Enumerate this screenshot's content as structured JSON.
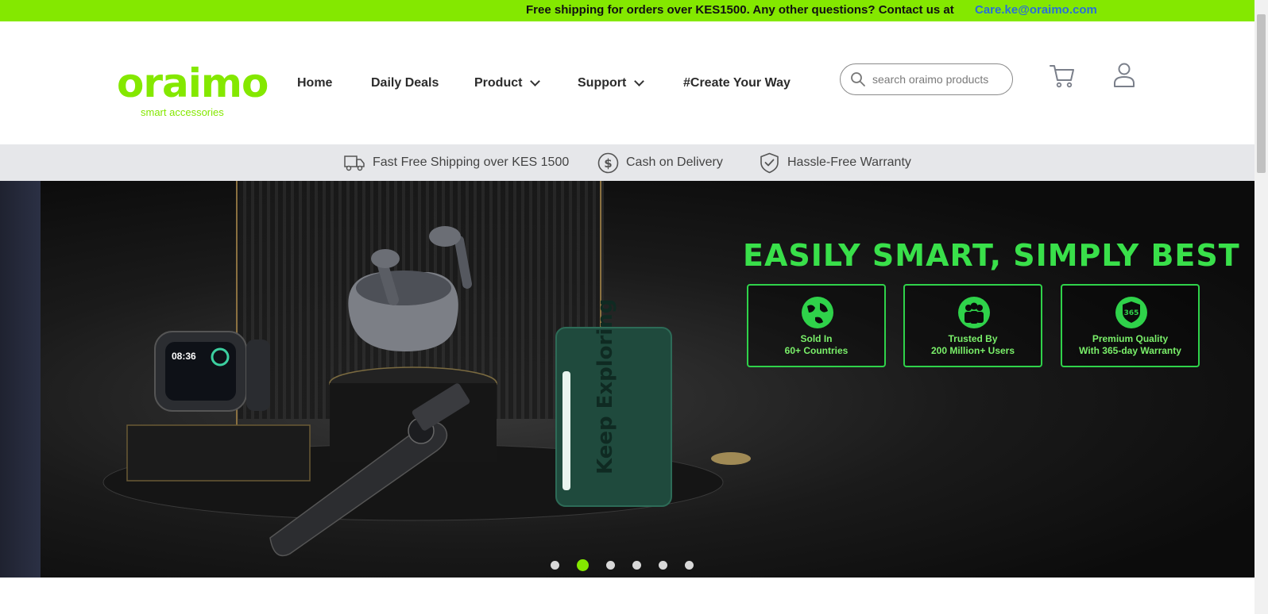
{
  "announcement": {
    "text": "Free shipping for orders over KES1500. Any other questions? Contact us at",
    "link": "Care.ke@oraimo.com"
  },
  "brand": {
    "name": "oraimo",
    "tagline": "smart accessories",
    "accent_color": "#84e800"
  },
  "nav": {
    "home": "Home",
    "daily_deals": "Daily Deals",
    "product": "Product",
    "support": "Support",
    "create": "#Create Your Way"
  },
  "search": {
    "placeholder": "search oraimo products",
    "icon": "search-icon"
  },
  "header_icons": [
    "cart-icon",
    "user-icon"
  ],
  "features": [
    {
      "icon": "truck-icon",
      "label": "Fast Free Shipping over KES 1500"
    },
    {
      "icon": "dollar-icon",
      "label": "Cash on Delivery"
    },
    {
      "icon": "shield-check-icon",
      "label": "Hassle-Free Warranty"
    }
  ],
  "hero": {
    "headline": "EASILY SMART, SIMPLY BEST",
    "highlight_color": "#39e04a",
    "badges": [
      {
        "icon": "globe-icon",
        "line1": "Sold In",
        "line2": "60+ Countries"
      },
      {
        "icon": "users-icon",
        "line1": "Trusted By",
        "line2": "200 Million+ Users"
      },
      {
        "icon": "warranty-365-icon",
        "badge_text": "365",
        "line1": "Premium Quality",
        "line2": "With 365-day Warranty"
      }
    ],
    "slides_total": 6,
    "active_slide": 2
  }
}
